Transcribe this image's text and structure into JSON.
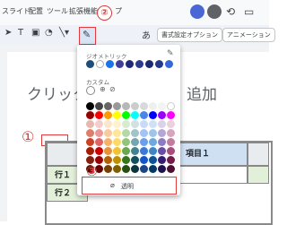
{
  "menu": {
    "items": [
      "スライド",
      "配置",
      "ツール",
      "拡張機能",
      "プ"
    ]
  },
  "markers": {
    "one": "①",
    "two": "②",
    "three": "③"
  },
  "toolbar": {
    "text_style_label": "あ",
    "format_options_label": "書式設定オプション",
    "animation_label": "アニメーション"
  },
  "slide": {
    "title_left": "クリック",
    "title_right": "追加"
  },
  "table": {
    "header_cell": "項目１",
    "row1": "行１",
    "row2": "行２"
  },
  "popup": {
    "geometric_label": "ジオメトリック",
    "custom_label": "カスタム",
    "transparent_label": "透明",
    "theme_colors": [
      "#1f4e79",
      "#ffffff",
      "#1a73e8",
      "#3f3f9a",
      "#1e2a78",
      "#2b3b8f",
      "#1a2c6e",
      "#243a8a",
      "#3567d8"
    ],
    "grid_rows": [
      [
        "#000000",
        "#434343",
        "#666666",
        "#999999",
        "#b7b7b7",
        "#cccccc",
        "#d9d9d9",
        "#efefef",
        "#f3f3f3",
        "#ffffff"
      ],
      [
        "#980000",
        "#ff0000",
        "#ff9900",
        "#ffff00",
        "#00ff00",
        "#00ffff",
        "#4a86e8",
        "#0000ff",
        "#9900ff",
        "#ff00ff"
      ],
      [
        "#e6b8af",
        "#f4cccc",
        "#fce5cd",
        "#fff2cc",
        "#d9ead3",
        "#d0e0e3",
        "#c9daf8",
        "#cfe2f3",
        "#d9d2e9",
        "#ead1dc"
      ],
      [
        "#dd7e6b",
        "#ea9999",
        "#f9cb9c",
        "#ffe599",
        "#b6d7a8",
        "#a2c4c9",
        "#a4c2f4",
        "#9fc5e8",
        "#b4a7d6",
        "#d5a6bd"
      ],
      [
        "#cc4125",
        "#e06666",
        "#f6b26b",
        "#ffd966",
        "#93c47d",
        "#76a5af",
        "#6d9eeb",
        "#6fa8dc",
        "#8e7cc3",
        "#c27ba0"
      ],
      [
        "#a61c00",
        "#cc0000",
        "#e69138",
        "#f1c232",
        "#6aa84f",
        "#45818e",
        "#3c78d8",
        "#3d85c6",
        "#674ea7",
        "#a64d79"
      ],
      [
        "#85200c",
        "#990000",
        "#b45f06",
        "#bf9000",
        "#38761d",
        "#134f5c",
        "#1155cc",
        "#0b5394",
        "#351c75",
        "#741b47"
      ],
      [
        "#5b0f00",
        "#660000",
        "#783f04",
        "#7f6000",
        "#274e13",
        "#0c343d",
        "#1c4587",
        "#073763",
        "#20124d",
        "#4c1130"
      ]
    ]
  },
  "icons": [
    "pointer-icon",
    "text-box-icon",
    "image-icon",
    "shape-icon",
    "line-icon",
    "pen-icon",
    "avatar-icon",
    "history-icon",
    "comment-icon",
    "add-person-icon",
    "eyedropper-icon",
    "plus-icon",
    "transparent-icon"
  ]
}
